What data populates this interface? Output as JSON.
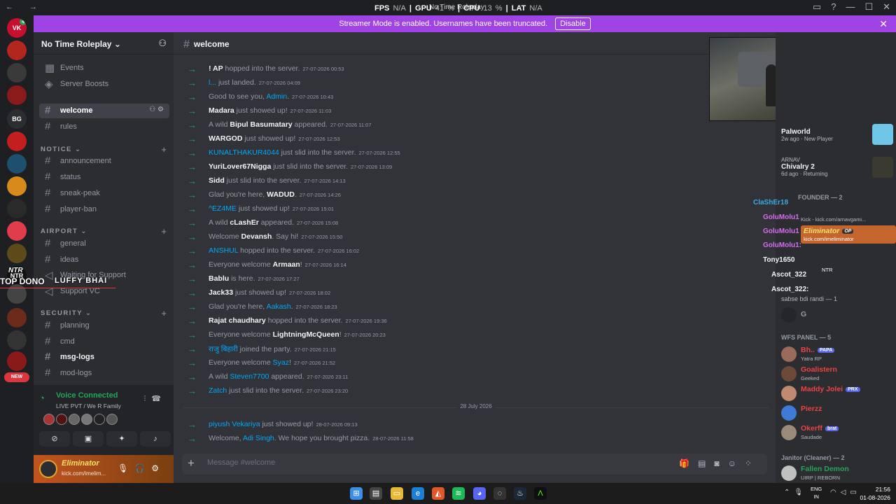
{
  "titlebar": {
    "title": "No Time Roleplay",
    "overlay_fps": "FPS",
    "overlay_fps_val": "N/A",
    "overlay_gpu": "GPU",
    "overlay_gpu_val": "41 %",
    "overlay_cpu": "CPU",
    "overlay_cpu_val": "13 %",
    "overlay_lat": "LAT",
    "overlay_lat_val": "N/A"
  },
  "banner": {
    "text": "Streamer Mode is enabled. Usernames have been truncated.",
    "button": "Disable"
  },
  "server": {
    "name": "No Time Roleplay"
  },
  "servers": [
    {
      "label": "VK",
      "color": "#c8102e",
      "badge": "4"
    },
    {
      "label": "",
      "color": "#b3261e"
    },
    {
      "label": "",
      "color": "#3a3a3a"
    },
    {
      "label": "",
      "color": "#8b1a1a"
    },
    {
      "label": "BG",
      "color": "#2b2d31"
    },
    {
      "label": "",
      "color": "#c41e1e"
    },
    {
      "label": "",
      "color": "#1f4f6f"
    },
    {
      "label": "",
      "color": "#d88a1a"
    },
    {
      "label": "",
      "color": "#2a2a2a"
    },
    {
      "label": "",
      "color": "#e03c4c"
    },
    {
      "label": "",
      "color": "#5c4a1a"
    },
    {
      "label": "NTR",
      "color": "#111"
    },
    {
      "label": "",
      "color": "#444"
    },
    {
      "label": "",
      "color": "#6b2a1a"
    },
    {
      "label": "",
      "color": "#333"
    },
    {
      "label": "",
      "color": "#8a1a1a"
    }
  ],
  "new_badge": "NEW",
  "channels": {
    "events": "Events",
    "boosts": "Server Boosts",
    "welcome": "welcome",
    "rules": "rules",
    "cat_notice": "NOTICE",
    "announcement": "announcement",
    "status": "status",
    "sneak_peak": "sneak-peak",
    "player_ban": "player-ban",
    "cat_airport": "AIRPORT",
    "general": "general",
    "ideas": "ideas",
    "waiting": "Waiting for Support",
    "support_vc": "Support VC",
    "cat_security": "SECURITY",
    "planning": "planning",
    "cmd": "cmd",
    "msg_logs": "msg-logs",
    "mod_logs": "mod-logs"
  },
  "voice": {
    "status": "Voice Connected",
    "channel": "LIVE PVT / We R Family"
  },
  "user": {
    "name": "Eliminator",
    "status": "kick.com/imelim..."
  },
  "ntr_overlay": {
    "top": "NTR",
    "name1": "TOP DONO",
    "name2": "LUFFY BHAI"
  },
  "channel_header": {
    "name": "welcome"
  },
  "messages": [
    {
      "user": "! AP",
      "text": " hopped into the server.",
      "ts": "27-07-2026 00:53",
      "link": false,
      "pre": ""
    },
    {
      "user": "l...",
      "text": " just landed.",
      "ts": "27-07-2026 04:09",
      "link": true,
      "pre": ""
    },
    {
      "user": "Admin",
      "text": ".",
      "ts": "27-07-2026 10:43",
      "link": true,
      "pre": "Good to see you, "
    },
    {
      "user": "Madara",
      "text": " just showed up!",
      "ts": "27-07-2026 11:03",
      "link": false,
      "pre": ""
    },
    {
      "user": "Bipul Basumatary",
      "text": " appeared.",
      "ts": "27-07-2026 11:07",
      "link": false,
      "pre": "A wild "
    },
    {
      "user": "WARGOD",
      "text": " just showed up!",
      "ts": "27-07-2026 12:53",
      "link": false,
      "pre": ""
    },
    {
      "user": "KUNALTHAKUR4044",
      "text": " just slid into the server.",
      "ts": "27-07-2026 12:55",
      "link": true,
      "pre": ""
    },
    {
      "user": "YuriLover67Nigga",
      "text": " just slid into the server.",
      "ts": "27-07-2026 13:09",
      "link": false,
      "pre": ""
    },
    {
      "user": "Sidd",
      "text": " just slid into the server.",
      "ts": "27-07-2026 14:13",
      "link": false,
      "pre": ""
    },
    {
      "user": "WADUD",
      "text": ".",
      "ts": "27-07-2026 14:26",
      "link": false,
      "pre": "Glad you're here, "
    },
    {
      "user": "^EZ4ME",
      "text": " just showed up!",
      "ts": "27-07-2026 15:01",
      "link": true,
      "pre": ""
    },
    {
      "user": "cLashEr",
      "text": " appeared.",
      "ts": "27-07-2026 15:08",
      "link": false,
      "pre": "A wild "
    },
    {
      "user": "Devansh",
      "text": ". Say hi!",
      "ts": "27-07-2026 15:50",
      "link": false,
      "pre": "Welcome "
    },
    {
      "user": "ANSHUL",
      "text": " hopped into the server.",
      "ts": "27-07-2026 16:02",
      "link": true,
      "pre": ""
    },
    {
      "user": "Armaan",
      "text": "!",
      "ts": "27-07-2026 16:14",
      "link": false,
      "pre": "Everyone welcome "
    },
    {
      "user": "Bablu",
      "text": " is here.",
      "ts": "27-07-2026 17:27",
      "link": false,
      "pre": ""
    },
    {
      "user": "Jack33",
      "text": " just showed up!",
      "ts": "27-07-2026 18:02",
      "link": false,
      "pre": ""
    },
    {
      "user": "Aakash",
      "text": ".",
      "ts": "27-07-2026 18:23",
      "link": true,
      "pre": "Glad you're here, "
    },
    {
      "user": "Rajat chaudhary",
      "text": " hopped into the server.",
      "ts": "27-07-2026 19:36",
      "link": false,
      "pre": ""
    },
    {
      "user": "LightningMcQueen",
      "text": "!",
      "ts": "27-07-2026 20:23",
      "link": false,
      "pre": "Everyone welcome "
    },
    {
      "user": "राजु बिहारी",
      "text": " joined the party.",
      "ts": "27-07-2026 21:15",
      "link": true,
      "pre": ""
    },
    {
      "user": "Syaz",
      "text": "!",
      "ts": "27-07-2026 21:52",
      "link": true,
      "pre": "Everyone welcome "
    },
    {
      "user": "Steven7700",
      "text": " appeared.",
      "ts": "27-07-2026 23:11",
      "link": true,
      "pre": "A wild "
    },
    {
      "user": "Zatch",
      "text": "  just slid into the server.",
      "ts": "27-07-2026 23:20",
      "link": true,
      "pre": ""
    }
  ],
  "date_divider": "28 July 2026",
  "messages2": [
    {
      "user": "piyush Vekariya",
      "text": " just showed up!",
      "ts": "28-07-2026 09:13",
      "link": true,
      "pre": ""
    },
    {
      "user": "Adi Singh",
      "text": ". We hope you brought pizza.",
      "ts": "28-07-2026 11:58",
      "link": true,
      "pre": "Welcome, "
    }
  ],
  "composer": {
    "placeholder": "Message #welcome"
  },
  "activity": [
    {
      "name": "Palworld",
      "sub": "2w ago · New Player"
    },
    {
      "who": "ARNAV",
      "name": "Chivalry 2",
      "sub": "6d ago · Returning"
    }
  ],
  "member_overlay": [
    {
      "name": "ClaShEr18",
      "color": "#3ba9e6"
    },
    {
      "name": "GoluMolu1",
      "color": "#d56cf0"
    },
    {
      "name": "GoluMolu1",
      "color": "#d56cf0"
    },
    {
      "name": "GoluMolu1:",
      "color": "#d56cf0"
    },
    {
      "name": "Tony1650",
      "color": "#f2f3f5"
    },
    {
      "name": "Ascot_322",
      "color": "#f2f3f5"
    },
    {
      "name": "Ascot_322:",
      "color": "#f2f3f5"
    }
  ],
  "member_groups": {
    "founder": "FOUNDER — 2",
    "kick_sub": "Kick - kick.com/arnavgami...",
    "elim_name": "Eliminator",
    "elim_tag": "OP",
    "elim_sub": "kick.com/imeliminator",
    "ntr_tag": "NTR",
    "sabse": "sabse bdi randi — 1",
    "g_name": "G",
    "wfs": "WFS PANEL — 5",
    "janitor": "Janitor (Cleaner) — 2"
  },
  "members": [
    {
      "name": "Bh..",
      "tag": "PAPA",
      "sub": "Yatra RP",
      "color": "#ed4245"
    },
    {
      "name": "Goalistern",
      "tag": "",
      "sub": "Geeked",
      "color": "#ed4245"
    },
    {
      "name": "Maddy Jolei",
      "tag": "PRX",
      "sub": "",
      "color": "#ed4245"
    },
    {
      "name": "Pierzz",
      "tag": "",
      "sub": "",
      "color": "#ed4245"
    },
    {
      "name": "Okerff",
      "tag": "brat",
      "sub": "Saudade",
      "color": "#ed4245"
    }
  ],
  "janitor_member": {
    "name": "Fallen Demon",
    "sub": "UIRP | REBORN",
    "color": "#23a55a"
  },
  "taskbar": {
    "time": "21:56",
    "date": "01-08-2026",
    "lang1": "ENG",
    "lang2": "IN"
  }
}
